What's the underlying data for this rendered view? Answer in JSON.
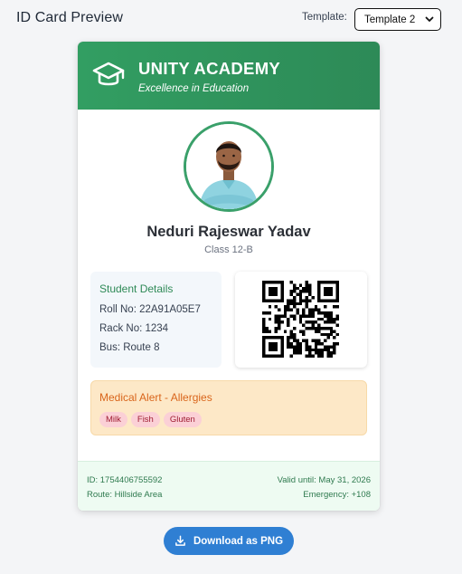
{
  "page": {
    "title": "ID Card Preview"
  },
  "template": {
    "label": "Template:",
    "selected": "Template 2"
  },
  "card": {
    "school_name": "UNITY ACADEMY",
    "tagline": "Excellence in Education",
    "student_name": "Neduri Rajeswar Yadav",
    "student_class": "Class 12-B",
    "details": {
      "title": "Student Details",
      "roll": "Roll No: 22A91A05E7",
      "rack": "Rack No: 1234",
      "bus": "Bus: Route 8"
    },
    "medical": {
      "title": "Medical Alert - Allergies",
      "allergies": [
        "Milk",
        "Fish",
        "Gluten"
      ]
    },
    "footer": {
      "id": "ID: 1754406755592",
      "route": "Route: Hillside Area",
      "valid_until": "Valid until: May 31, 2026",
      "emergency": "Emergency: +108"
    }
  },
  "actions": {
    "download_label": "Download as PNG"
  },
  "colors": {
    "header_green": "#329e62",
    "accent_blue": "#2f7fd3",
    "medical_bg": "#fde8c7",
    "chip_bg": "#fbd0d6"
  },
  "icons": {
    "header": "graduation-cap-icon",
    "download": "download-icon",
    "select": "chevron-down-icon"
  }
}
